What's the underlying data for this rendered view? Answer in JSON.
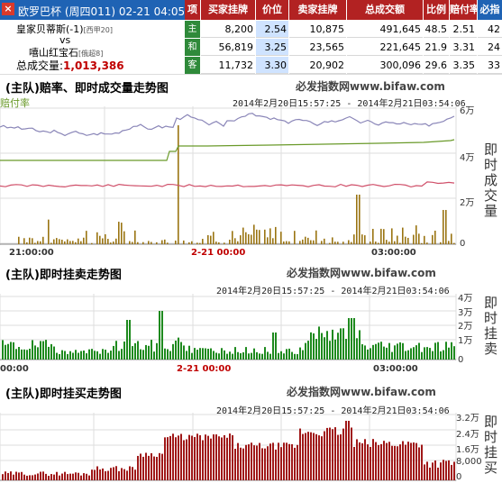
{
  "match": {
    "title": "欧罗巴杯 (周四011) 02-21 04:05",
    "home_team": "皇家贝蒂斯(-1)",
    "home_rank": "[西甲20]",
    "vs": "vs",
    "away_team": "嘻山红宝石",
    "away_rank": "[俄超8]",
    "total_label": "总成交量:",
    "total_value": "1,013,386"
  },
  "table": {
    "headers": [
      "项",
      "买家挂牌",
      "价位",
      "卖家挂牌",
      "总成交额",
      "比例",
      "赔付率",
      "必指"
    ],
    "rows": [
      {
        "side": "主",
        "buy": "8,200",
        "price": "2.54",
        "sell": "10,875",
        "total": "491,645",
        "ratio": "48.5",
        "payout": "2.51",
        "index": "42"
      },
      {
        "side": "和",
        "buy": "56,819",
        "price": "3.25",
        "sell": "23,565",
        "total": "221,645",
        "ratio": "21.9",
        "payout": "3.31",
        "index": "24"
      },
      {
        "side": "客",
        "buy": "11,732",
        "price": "3.30",
        "sell": "20,902",
        "total": "300,096",
        "ratio": "29.6",
        "payout": "3.35",
        "index": "33"
      }
    ]
  },
  "charts": {
    "brand_cn": "必发指数网",
    "brand_url": "www.bifaw.com",
    "range": "2014年2月20日15:57:25 - 2014年2月21日03:54:06",
    "chart1": {
      "title": "(主队)赔率、即时成交量走势图",
      "legend": "赔付率",
      "side_title": "即时成交量",
      "yticks": [
        "6万",
        "4万",
        "2万",
        "0"
      ],
      "xticks": [
        "21:00:00",
        "2-21 00:00",
        "03:00:00"
      ]
    },
    "chart2": {
      "title": "(主队)即时挂卖走势图",
      "side_title": "即时挂卖",
      "yticks": [
        "4万",
        "3万",
        "2万",
        "1万",
        "0"
      ],
      "xticks": [
        "00:00",
        "2-21 00:00",
        "03:00:00"
      ]
    },
    "chart3": {
      "title": "(主队)即时挂买走势图",
      "side_title": "即时挂买",
      "yticks": [
        "3.2万",
        "2.4万",
        "1.6万",
        "8,000",
        "0"
      ]
    }
  },
  "colors": {
    "header_blue": "#1f63b4",
    "header_red": "#b22222",
    "side_green": "#2f8a3a",
    "price_blue": "#cfe3ff",
    "payout_line": "#8a86b8",
    "draw_line": "#6a9a2a",
    "away_line": "#d0506a",
    "volume_bar": "#9a7412",
    "sell_bar": "#1e8a1e",
    "buy_bar": "#a01818"
  }
}
